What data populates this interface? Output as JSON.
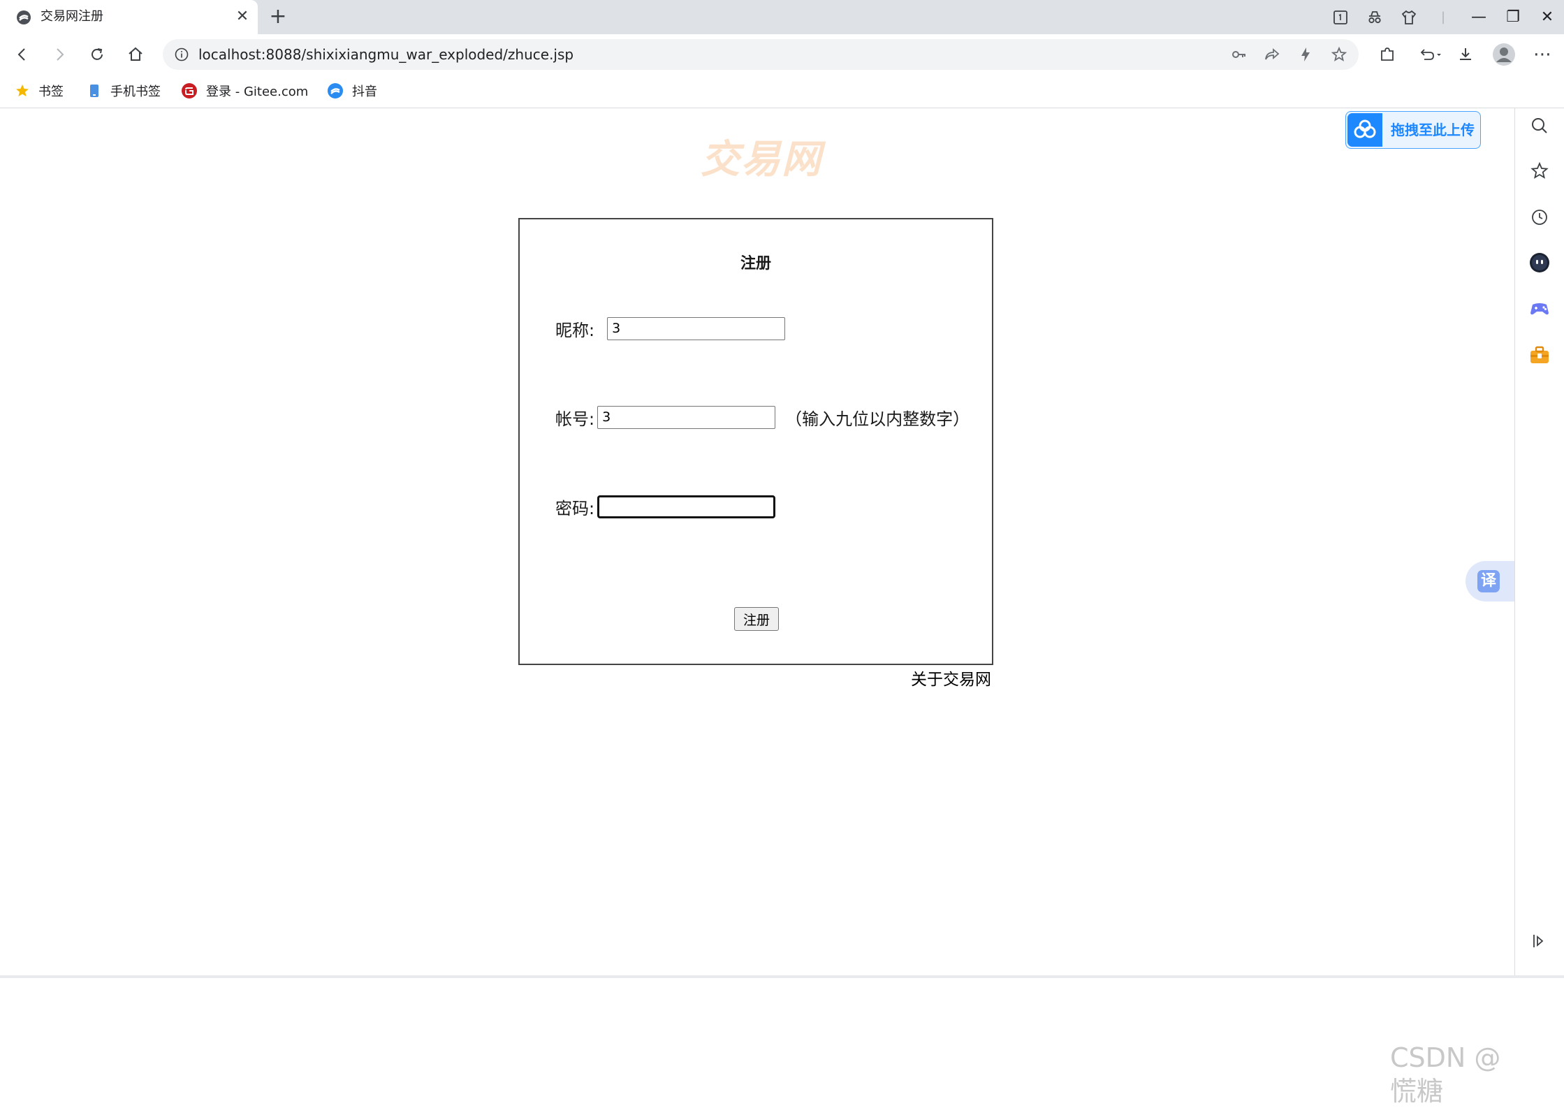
{
  "browser": {
    "tab": {
      "title": "交易网注册",
      "close": "✕"
    },
    "new_tab": "+",
    "address": {
      "url": "localhost:8088/shixixiangmu_war_exploded/zhuce.jsp"
    },
    "window_buttons": {
      "minimize": "—",
      "restore": "❐",
      "close": "✕"
    },
    "menu": "⋯",
    "bookmarks": [
      {
        "label": "书签",
        "icon": "star-icon"
      },
      {
        "label": "手机书签",
        "icon": "phone-icon"
      },
      {
        "label": "登录 - Gitee.com",
        "icon": "gitee-icon"
      },
      {
        "label": "抖音",
        "icon": "browser-e-icon"
      }
    ]
  },
  "page": {
    "site_title": "交易网",
    "form": {
      "heading": "注册",
      "nickname": {
        "label": "昵称:",
        "value": "3"
      },
      "account": {
        "label": "帐号:",
        "value": "3",
        "hint": "（输入九位以内整数字）"
      },
      "password": {
        "label": "密码:",
        "value": ""
      },
      "submit": "注册"
    },
    "about_link": "关于交易网",
    "upload_widget": {
      "label": "拖拽至此上传"
    },
    "translate": {
      "label": "译"
    }
  },
  "watermark": "CSDN @慌糖",
  "colors": {
    "title": "#fbe1c9",
    "accent_blue": "#1e88ff",
    "tabstrip": "#dee1e6",
    "omnibox": "#f1f3f4"
  }
}
